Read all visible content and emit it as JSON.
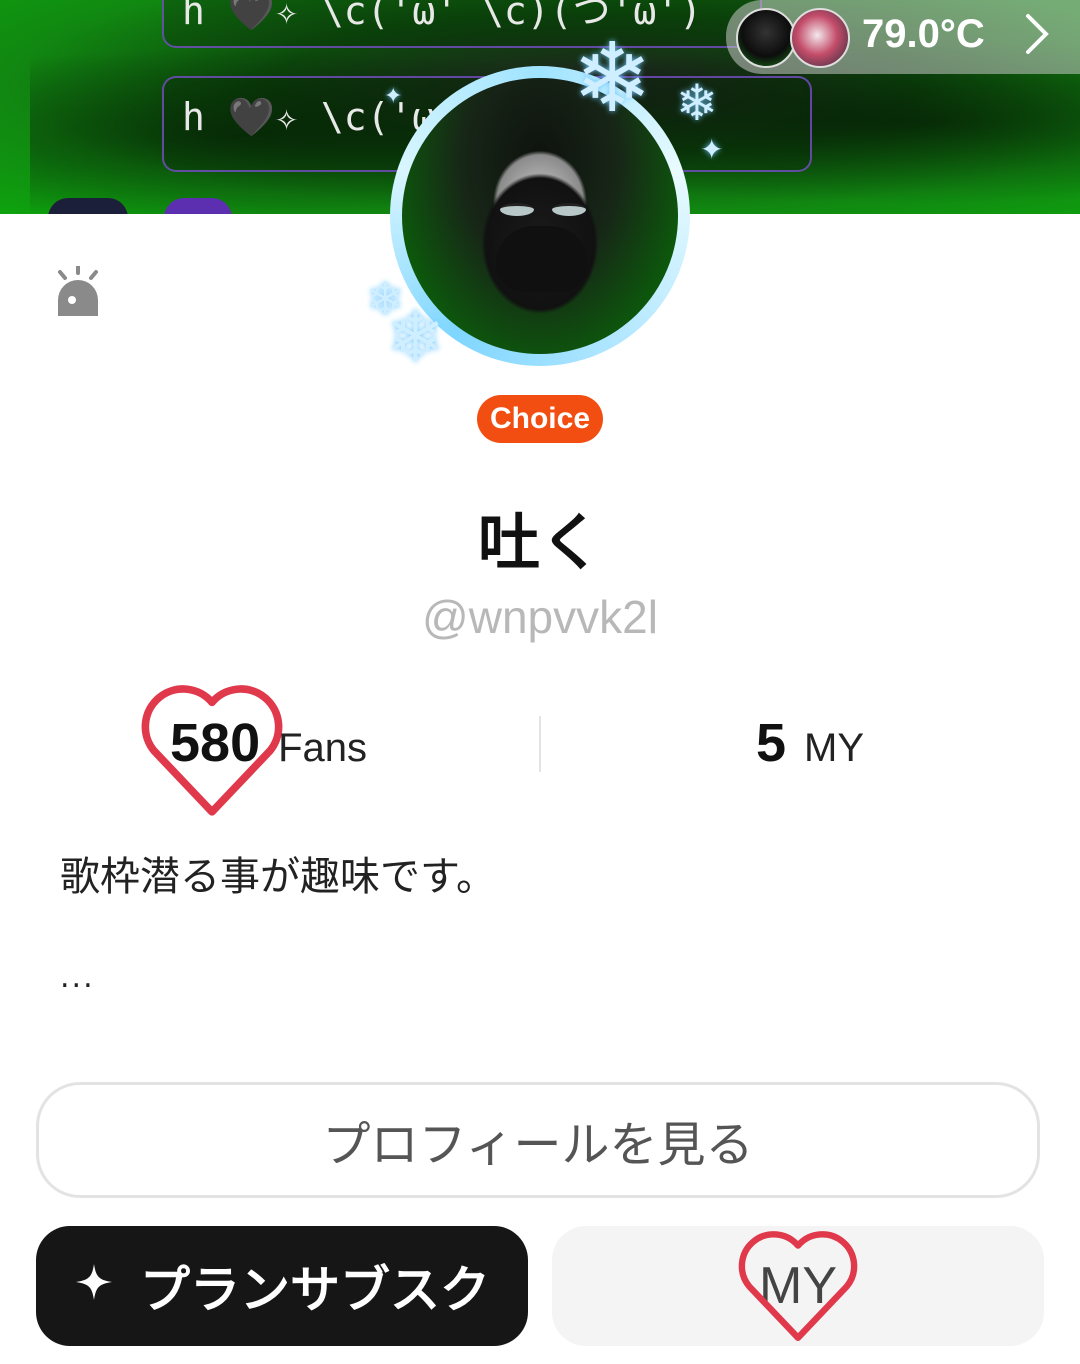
{
  "banner": {
    "bubble_top": "h 🖤✧ \\c('ω' \\c)(つ'ω')",
    "bubble_bottom": "h 🖤✧ \\c('ω",
    "temperature": "79.0°C"
  },
  "profile": {
    "badge": "Choice",
    "display_name": "吐く",
    "handle": "@wnpvvk2l",
    "bio": "歌枠潜る事が趣味です。",
    "bio_more": "..."
  },
  "stats": {
    "fans_count": "580",
    "fans_label": "Fans",
    "my_count": "5",
    "my_label": "MY"
  },
  "buttons": {
    "view_profile": "プロフィールを見る",
    "plan_subscribe": "プランサブスク",
    "my": "MY"
  },
  "colors": {
    "badge": "#f24e12",
    "heart": "#e0394b",
    "banner_green": "#0ea30e",
    "plan_button": "#161616"
  },
  "icons": [
    "alarm-icon",
    "chevron-right-icon",
    "heart-icon",
    "sparkle-icon",
    "snowflake-icon"
  ]
}
